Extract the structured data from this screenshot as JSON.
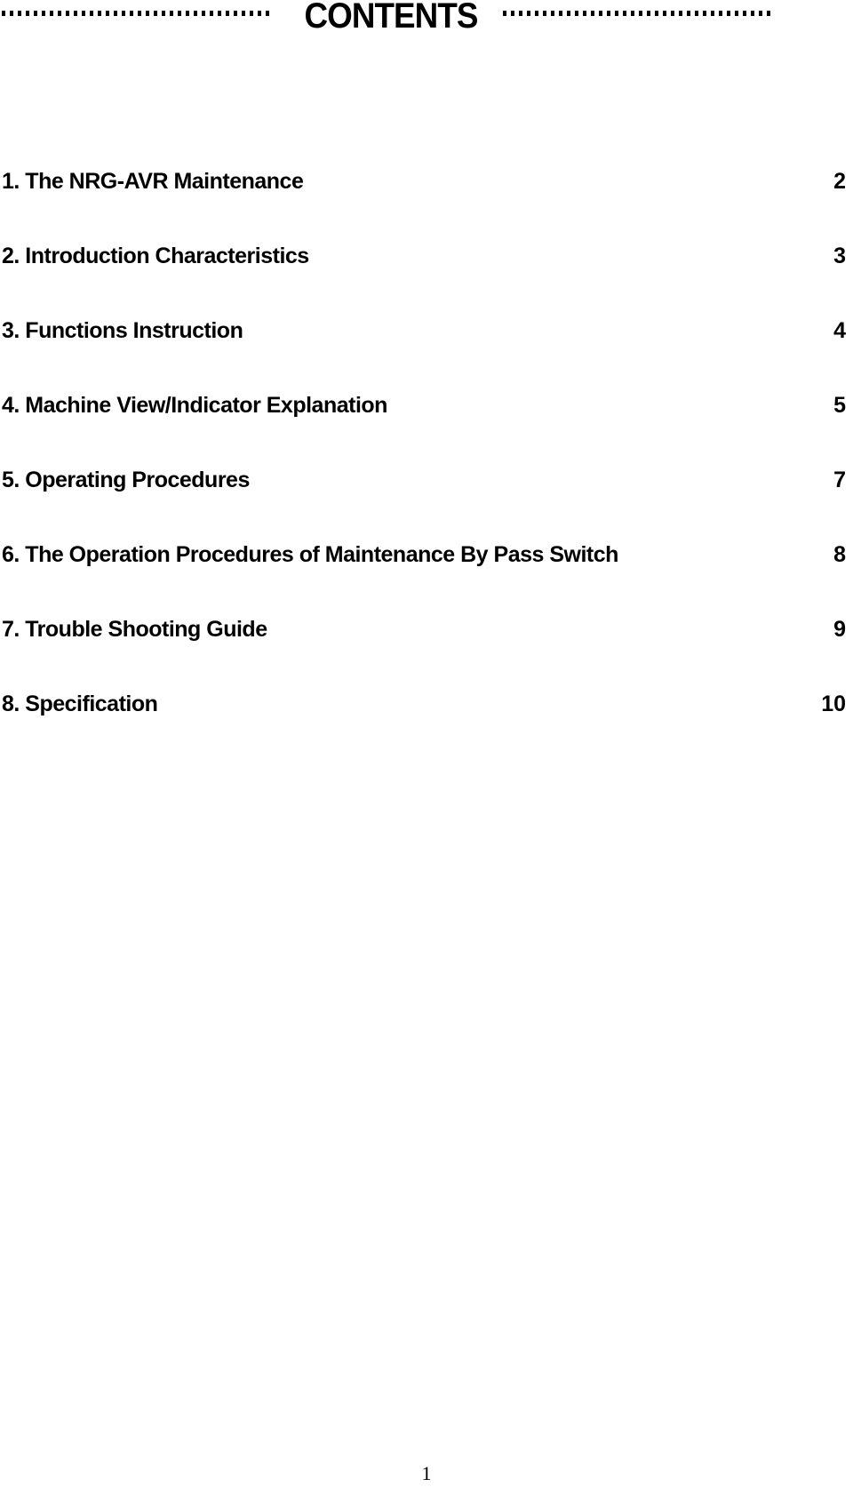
{
  "header": {
    "title": "CONTENTS"
  },
  "toc": [
    {
      "label": "1. The NRG-AVR Maintenance",
      "page": "2"
    },
    {
      "label": "2. Introduction Characteristics",
      "page": "3"
    },
    {
      "label": "3. Functions Instruction",
      "page": "4"
    },
    {
      "label": "4. Machine View/Indicator Explanation",
      "page": "5"
    },
    {
      "label": "5. Operating Procedures",
      "page": "7"
    },
    {
      "label": "6. The Operation Procedures of Maintenance By Pass Switch",
      "page": "8"
    },
    {
      "label": "7. Trouble Shooting Guide",
      "page": "9"
    },
    {
      "label": "8. Specification",
      "page": "10"
    }
  ],
  "footer": {
    "page_number": "1"
  }
}
